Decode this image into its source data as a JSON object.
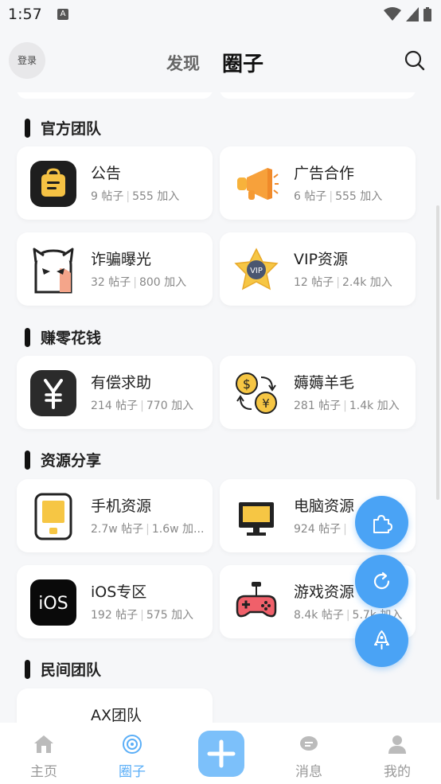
{
  "status_bar": {
    "time": "1:57",
    "notification_icon": "A"
  },
  "header": {
    "login_label": "登录",
    "tab_discover": "发现",
    "tab_circle": "圈子"
  },
  "sections": [
    {
      "title": "官方团队",
      "items": [
        {
          "name": "公告",
          "posts": "9 帖子",
          "joins": "555 加入",
          "icon": "notice-bag-icon"
        },
        {
          "name": "广告合作",
          "posts": "6 帖子",
          "joins": "555 加入",
          "icon": "megaphone-icon"
        },
        {
          "name": "诈骗曝光",
          "posts": "32 帖子",
          "joins": "800 加入",
          "icon": "ghost-devil-icon"
        },
        {
          "name": "VIP资源",
          "posts": "12 帖子",
          "joins": "2.4k 加入",
          "icon": "vip-star-icon"
        }
      ]
    },
    {
      "title": "赚零花钱",
      "items": [
        {
          "name": "有偿求助",
          "posts": "214 帖子",
          "joins": "770 加入",
          "icon": "yen-icon"
        },
        {
          "name": "薅薅羊毛",
          "posts": "281 帖子",
          "joins": "1.4k 加入",
          "icon": "currency-exchange-icon"
        }
      ]
    },
    {
      "title": "资源分享",
      "items": [
        {
          "name": "手机资源",
          "posts": "2.7w 帖子",
          "joins": "1.6w 加...",
          "icon": "phone-icon"
        },
        {
          "name": "电脑资源",
          "posts": "924 帖子",
          "joins": "",
          "icon": "monitor-icon"
        },
        {
          "name": "iOS专区",
          "posts": "192 帖子",
          "joins": "575 加入",
          "icon": "ios-icon"
        },
        {
          "name": "游戏资源",
          "posts": "8.4k 帖子",
          "joins": "5.7k 加入",
          "icon": "gamepad-icon"
        }
      ]
    },
    {
      "title": "民间团队",
      "items": [
        {
          "name": "AX团队",
          "posts": "",
          "joins": "",
          "icon": "ax-team-icon"
        }
      ]
    }
  ],
  "bottom_nav": {
    "home": "主页",
    "circle": "圈子",
    "messages": "消息",
    "mine": "我的"
  },
  "colors": {
    "accent": "#4aa3f5",
    "active_nav": "#5aaef7",
    "add_button": "#7cc0fa"
  }
}
